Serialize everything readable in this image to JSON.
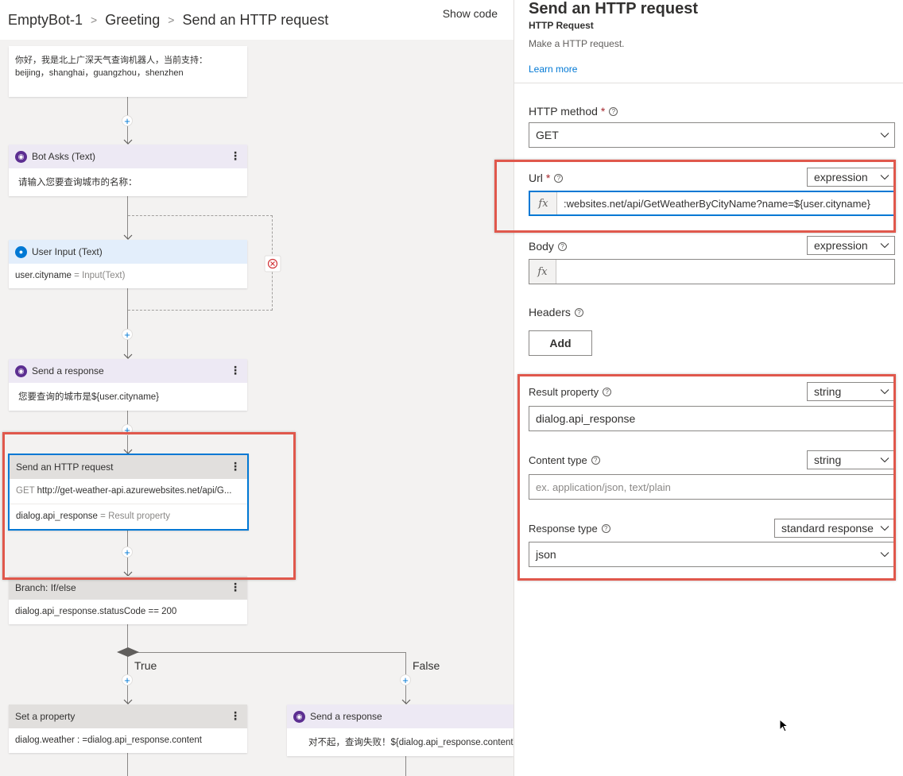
{
  "breadcrumb": {
    "bot": "EmptyBot-1",
    "dialog": "Greeting",
    "action": "Send an HTTP request"
  },
  "show_code": "Show code",
  "nodes": {
    "greeting_text": "你好，我是北上广深天气查询机器人，当前支持：",
    "greeting_cities": "beijing，shanghai，guangzhou，shenzhen",
    "bot_asks": {
      "title": "Bot Asks (Text)",
      "text": "请输入您要查询城市的名称："
    },
    "user_input": {
      "title": "User Input (Text)",
      "property": "user.cityname",
      "assign": "= Input(Text)"
    },
    "send_response": {
      "title": "Send a response",
      "text": "您要查询的城市是${user.cityname}"
    },
    "http": {
      "title": "Send an HTTP request",
      "method": "GET",
      "url": "http://get-weather-api.azurewebsites.net/api/G...",
      "result": "dialog.api_response",
      "result_note": "= Result property"
    },
    "branch": {
      "title": "Branch: If/else",
      "condition": "dialog.api_response.statusCode == 200",
      "true_label": "True",
      "false_label": "False"
    },
    "set_property": {
      "title": "Set a property",
      "text": "dialog.weather : =dialog.api_response.content"
    },
    "send_response_2": {
      "title": "Send a response",
      "text": "对不起，查询失败！${dialog.api_response.content}"
    }
  },
  "panel": {
    "title": "Send an HTTP request",
    "subtitle": "HTTP Request",
    "description": "Make a HTTP request.",
    "learn_more": "Learn more",
    "method_label": "HTTP method",
    "method_value": "GET",
    "url_label": "Url",
    "url_type": "expression",
    "url_value": ":websites.net/api/GetWeatherByCityName?name=${user.cityname}",
    "body_label": "Body",
    "body_type": "expression",
    "headers_label": "Headers",
    "add_button": "Add",
    "result_label": "Result property",
    "result_type": "string",
    "result_value": "dialog.api_response",
    "content_type_label": "Content type",
    "content_type_type": "string",
    "content_type_placeholder": "ex. application/json, text/plain",
    "response_type_label": "Response type",
    "response_type_type": "standard response",
    "response_type_value": "json",
    "fx": "fx",
    "required_mark": "*",
    "help_mark": "?"
  },
  "colors": {
    "accent": "#0078d4",
    "highlight": "#e0584c",
    "canvas": "#f3f2f1"
  }
}
